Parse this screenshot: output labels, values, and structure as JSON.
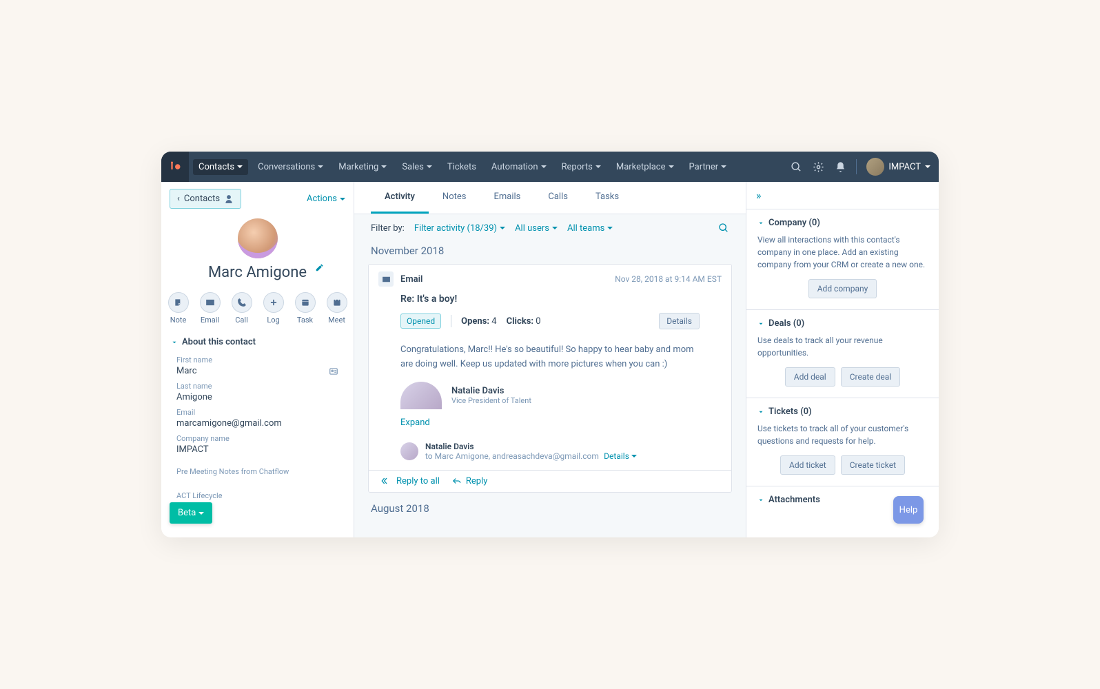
{
  "topnav": {
    "items": [
      "Contacts",
      "Conversations",
      "Marketing",
      "Sales",
      "Tickets",
      "Automation",
      "Reports",
      "Marketplace",
      "Partner"
    ],
    "activeIndex": 0,
    "account": "IMPACT"
  },
  "left": {
    "back": "Contacts",
    "actions": "Actions",
    "name": "Marc Amigone",
    "actionButtons": [
      "Note",
      "Email",
      "Call",
      "Log",
      "Task",
      "Meet"
    ],
    "aboutHeader": "About this contact",
    "fields": [
      {
        "label": "First name",
        "value": "Marc",
        "icon": true
      },
      {
        "label": "Last name",
        "value": "Amigone"
      },
      {
        "label": "Email",
        "value": "marcamigone@gmail.com"
      },
      {
        "label": "Company name",
        "value": "IMPACT"
      }
    ],
    "miniNotes": [
      "Pre Meeting Notes from Chatflow",
      "ACT Lifecycle"
    ]
  },
  "middle": {
    "tabs": [
      "Activity",
      "Notes",
      "Emails",
      "Calls",
      "Tasks"
    ],
    "activeTab": 0,
    "filterLabel": "Filter by:",
    "filterActivity": "Filter activity (18/39)",
    "filterUsers": "All users",
    "filterTeams": "All teams",
    "months": [
      "November 2018",
      "August 2018"
    ],
    "email": {
      "type": "Email",
      "timestamp": "Nov 28, 2018 at 9:14 AM EST",
      "subject": "Re: It's a boy!",
      "statusChip": "Opened",
      "opensLabel": "Opens:",
      "opensValue": "4",
      "clicksLabel": "Clicks:",
      "clicksValue": "0",
      "detailsBtn": "Details",
      "body": "Congratulations, Marc!! He's so beautiful! So happy to hear baby and mom are doing well. Keep us updated with more pictures when you can :)",
      "sigName": "Natalie Davis",
      "sigTitle": "Vice President of Talent",
      "expand": "Expand",
      "recipName": "Natalie Davis",
      "recipTo": "to Marc Amigone, andreasachdeva@gmail.com",
      "recipDetails": "Details"
    },
    "replyAll": "Reply to all",
    "reply": "Reply"
  },
  "right": {
    "sections": [
      {
        "title": "Company (0)",
        "desc": "View all interactions with this contact's company in one place. Add an existing company from your CRM or create a new one.",
        "buttons": [
          "Add company"
        ]
      },
      {
        "title": "Deals (0)",
        "desc": "Use deals to track all your revenue opportunities.",
        "buttons": [
          "Add deal",
          "Create deal"
        ]
      },
      {
        "title": "Tickets (0)",
        "desc": "Use tickets to track all of your customer's questions and requests for help.",
        "buttons": [
          "Add ticket",
          "Create ticket"
        ]
      },
      {
        "title": "Attachments",
        "desc": "",
        "buttons": []
      }
    ]
  },
  "floats": {
    "beta": "Beta",
    "help": "Help"
  }
}
